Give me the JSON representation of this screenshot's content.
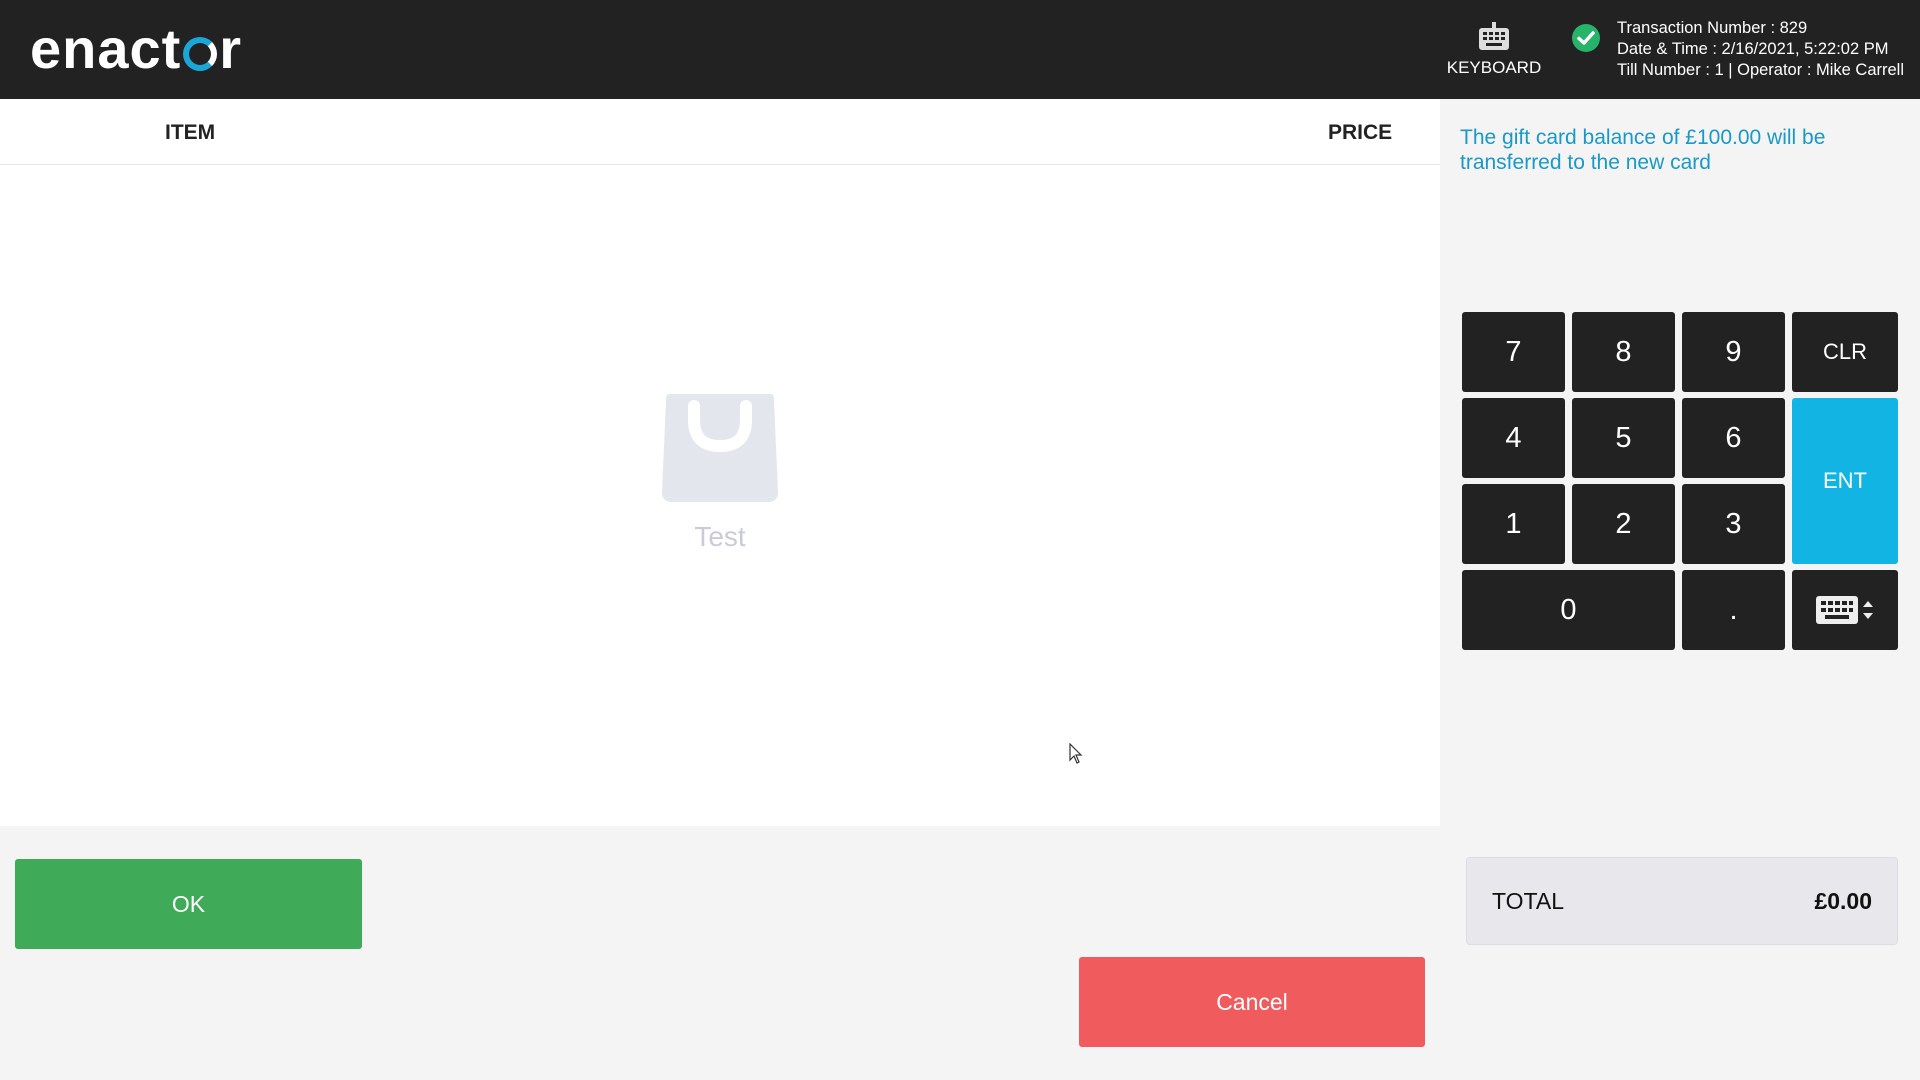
{
  "header": {
    "logo": "enactor",
    "keyboard_label": "KEYBOARD",
    "transaction_line": "Transaction Number : 829",
    "datetime_line": "Date & Time : 2/16/2021, 5:22:02 PM",
    "till_line": "Till Number : 1 | Operator : Mike Carrell",
    "status_icon": "check-circle-icon",
    "status_color": "#27b36a"
  },
  "items": {
    "col_item": "ITEM",
    "col_price": "PRICE",
    "empty_label": "Test",
    "empty_icon": "shopping-bag-icon"
  },
  "message": "The gift card balance of £100.00 will be transferred to the new card",
  "keypad": {
    "k7": "7",
    "k8": "8",
    "k9": "9",
    "clr": "CLR",
    "k4": "4",
    "k5": "5",
    "k6": "6",
    "ent": "ENT",
    "k1": "1",
    "k2": "2",
    "k3": "3",
    "k0": "0",
    "dot": ".",
    "toggle_icon": "keyboard-toggle-icon"
  },
  "actions": {
    "ok": "OK",
    "cancel": "Cancel"
  },
  "total": {
    "label": "TOTAL",
    "value": "£0.00"
  },
  "colors": {
    "accent": "#12b4e4",
    "ok": "#3faa58",
    "cancel": "#f05b5e",
    "topbar": "#222222",
    "message": "#1a99c9"
  }
}
